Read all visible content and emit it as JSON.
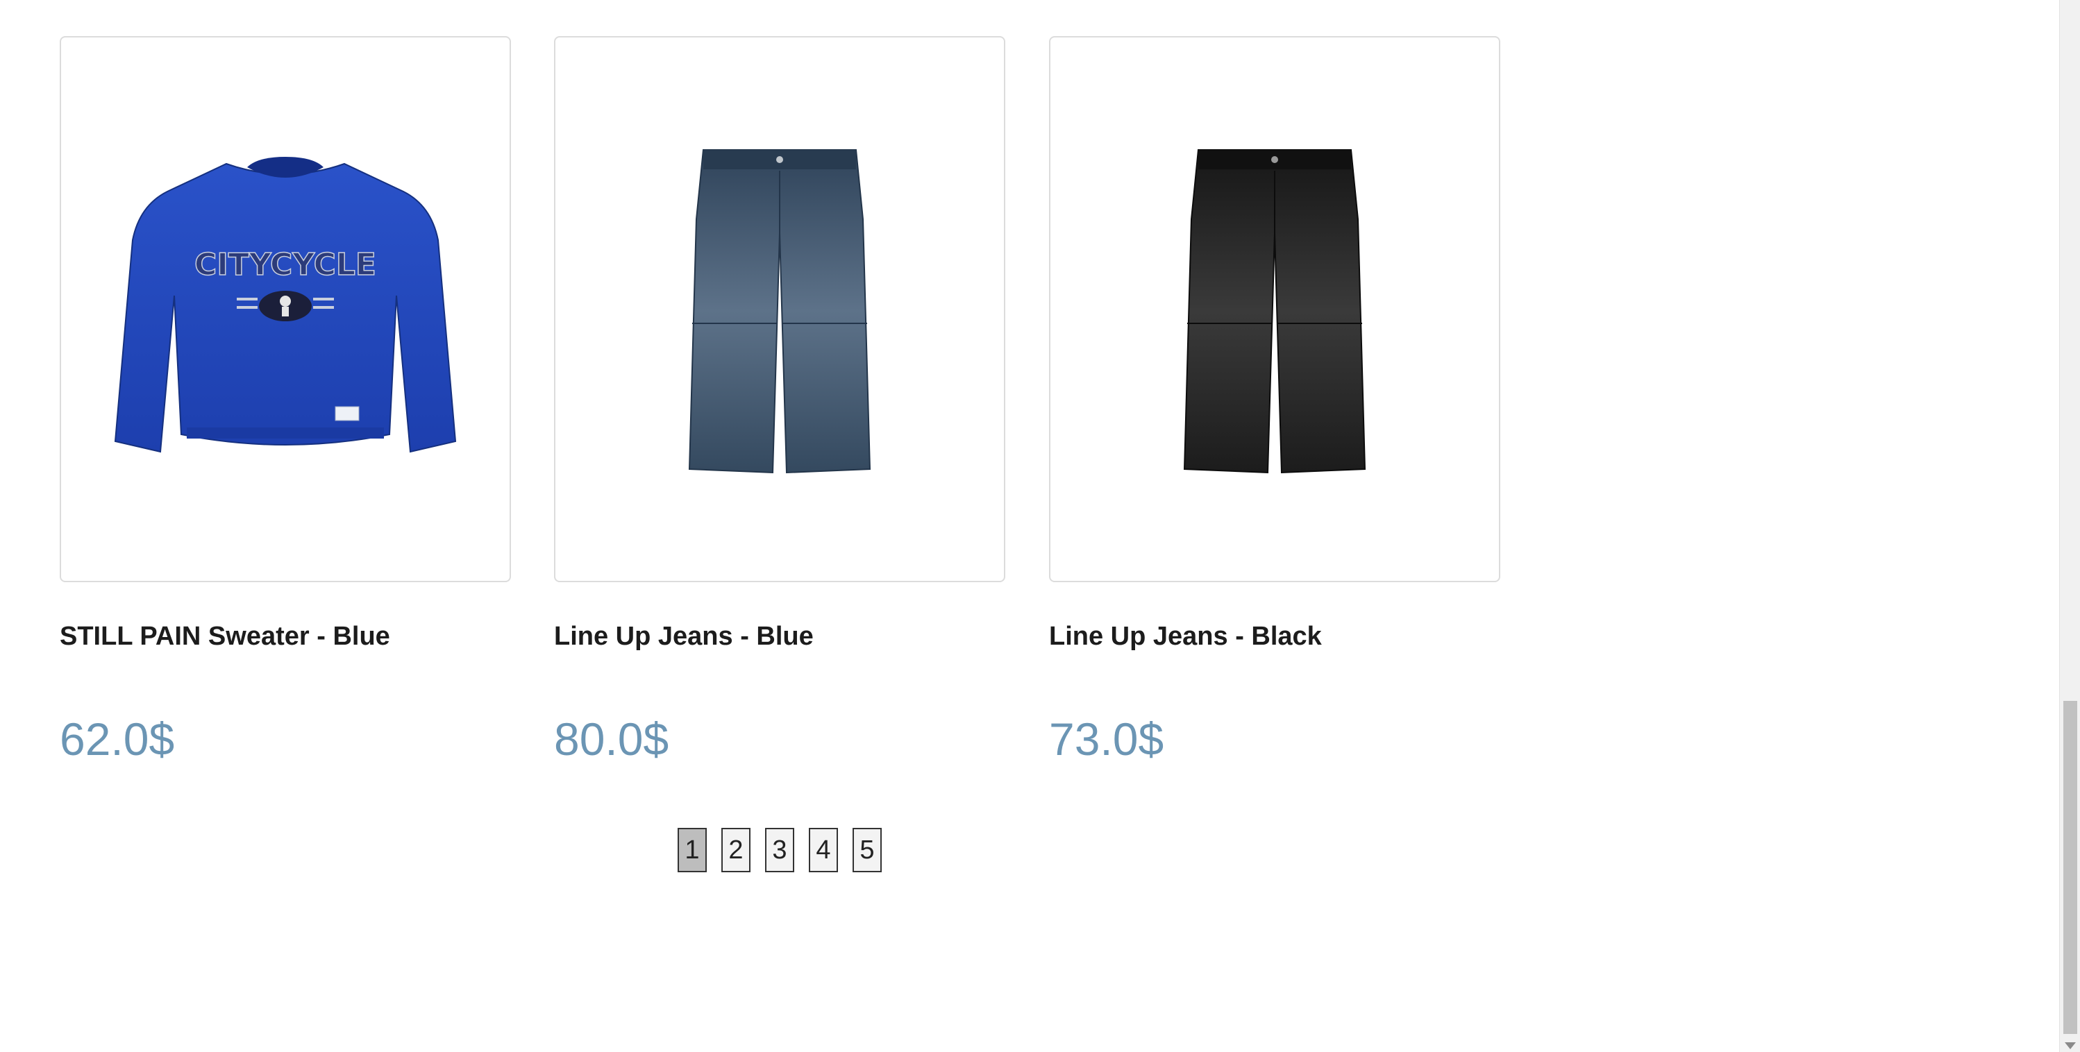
{
  "products": [
    {
      "name": "STILL PAIN Sweater - Blue",
      "price": "62.0$",
      "image_icon": "blue-sweater-image",
      "graphic_text": "CITYCYCLE"
    },
    {
      "name": "Line Up Jeans - Blue",
      "price": "80.0$",
      "image_icon": "blue-jeans-image"
    },
    {
      "name": "Line Up Jeans - Black",
      "price": "73.0$",
      "image_icon": "black-jeans-image"
    }
  ],
  "pagination": {
    "pages": [
      "1",
      "2",
      "3",
      "4",
      "5"
    ],
    "current": "1"
  },
  "colors": {
    "price": "#6b95b4",
    "sweater": "#1f44b8",
    "jeans_blue": "#3a4f66",
    "jeans_black": "#1e1e1e"
  }
}
